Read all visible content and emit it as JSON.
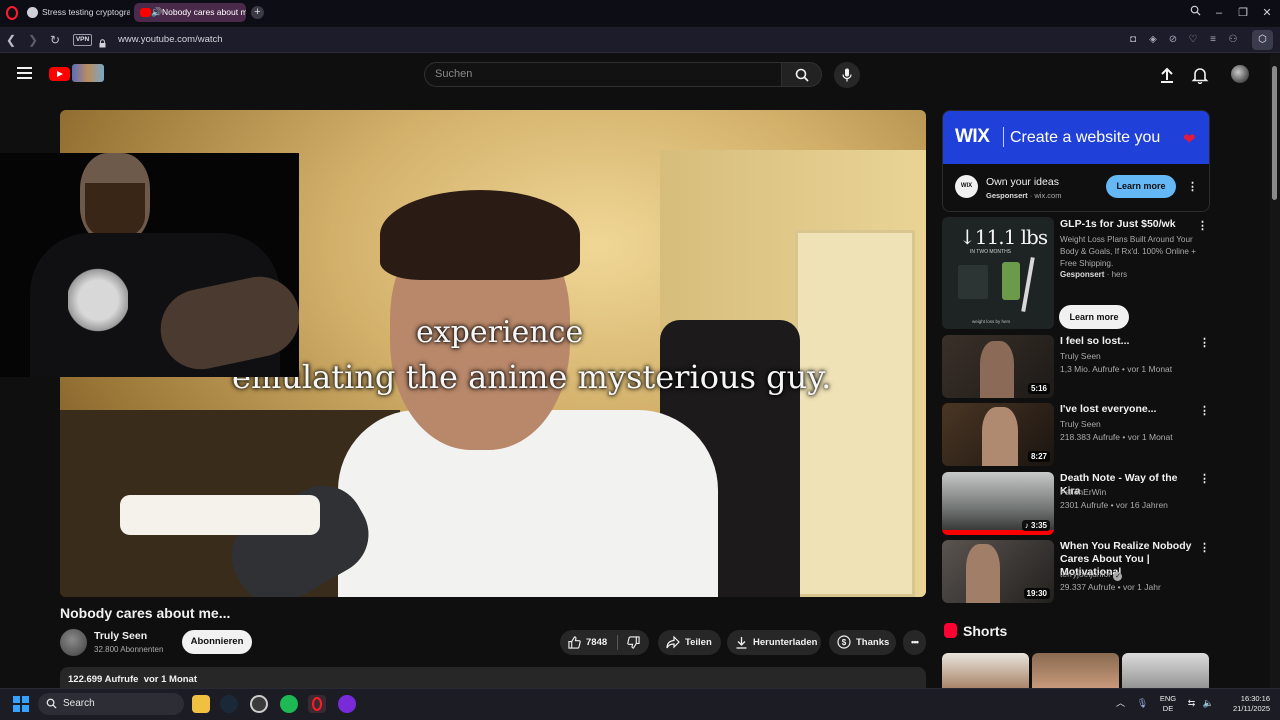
{
  "browser": {
    "tabs": [
      {
        "label": "Stress testing cryptograph"
      },
      {
        "label": "Nobody cares about m"
      }
    ],
    "new_tab_label": "+",
    "vpn_label": "VPN",
    "url": "www.youtube.com/watch"
  },
  "youtube": {
    "search_placeholder": "Suchen",
    "video": {
      "subtitle_line1": "experience",
      "subtitle_line2": "emulating the anime mysterious guy.",
      "title": "Nobody cares about me...",
      "channel": "Truly Seen",
      "subscribers": "32.800 Abonnenten",
      "subscribe_label": "Abonnieren",
      "likes": "7848",
      "share_label": "Teilen",
      "download_label": "Herunterladen",
      "thanks_label": "Thanks",
      "views": "122.699 Aufrufe",
      "date": "vor 1 Monat"
    },
    "ad_wix": {
      "logo": "WIX",
      "banner_text": "Create a website you",
      "avatar_text": "WIX",
      "headline": "Own your ideas",
      "sponsored": "Gesponsert",
      "domain": "wix.com",
      "cta": "Learn more"
    },
    "ad_glp": {
      "thumb_big": "↓11.1 lbs",
      "thumb_small": "IN TWO MONTHS",
      "thumb_footer": "weight loss by hers",
      "title": "GLP-1s for Just $50/wk",
      "description": "Weight Loss Plans Built Around Your Body & Goals, If Rx'd. 100% Online + Free Shipping.",
      "sponsored": "Gesponsert",
      "advertiser": "hers",
      "cta": "Learn more"
    },
    "recommendations": [
      {
        "title": "I feel so lost...",
        "channel": "Truly Seen",
        "views": "1,3 Mio. Aufrufe",
        "age": "vor 1 Monat",
        "duration": "5:16"
      },
      {
        "title": "I've lost everyone...",
        "channel": "Truly Seen",
        "views": "218.383 Aufrufe",
        "age": "vor 1 Monat",
        "duration": "8:27"
      },
      {
        "title": "Death Note - Way of the Kira",
        "channel": "FallenErWin",
        "views": "2301 Aufrufe",
        "age": "vor 16 Jahren",
        "duration": "♪ 3:35"
      },
      {
        "title": "When You Realize Nobody Cares About You | Motivational",
        "channel": "terryjoeljunior",
        "views": "29.337 Aufrufe",
        "age": "vor 1 Jahr",
        "duration": "19:30"
      }
    ],
    "shorts_label": "Shorts"
  },
  "taskbar": {
    "search_label": "Search",
    "lang_line1": "ENG",
    "lang_line2": "DE",
    "time": "16:30:16",
    "date": "21/11/2025"
  },
  "colors": {
    "youtube_red": "#ff0000",
    "wix_blue": "#2041d9",
    "learn_more_blue": "#65b8f6",
    "opera_red": "#ff1b2d",
    "windows_blue": "#35a2ff"
  }
}
